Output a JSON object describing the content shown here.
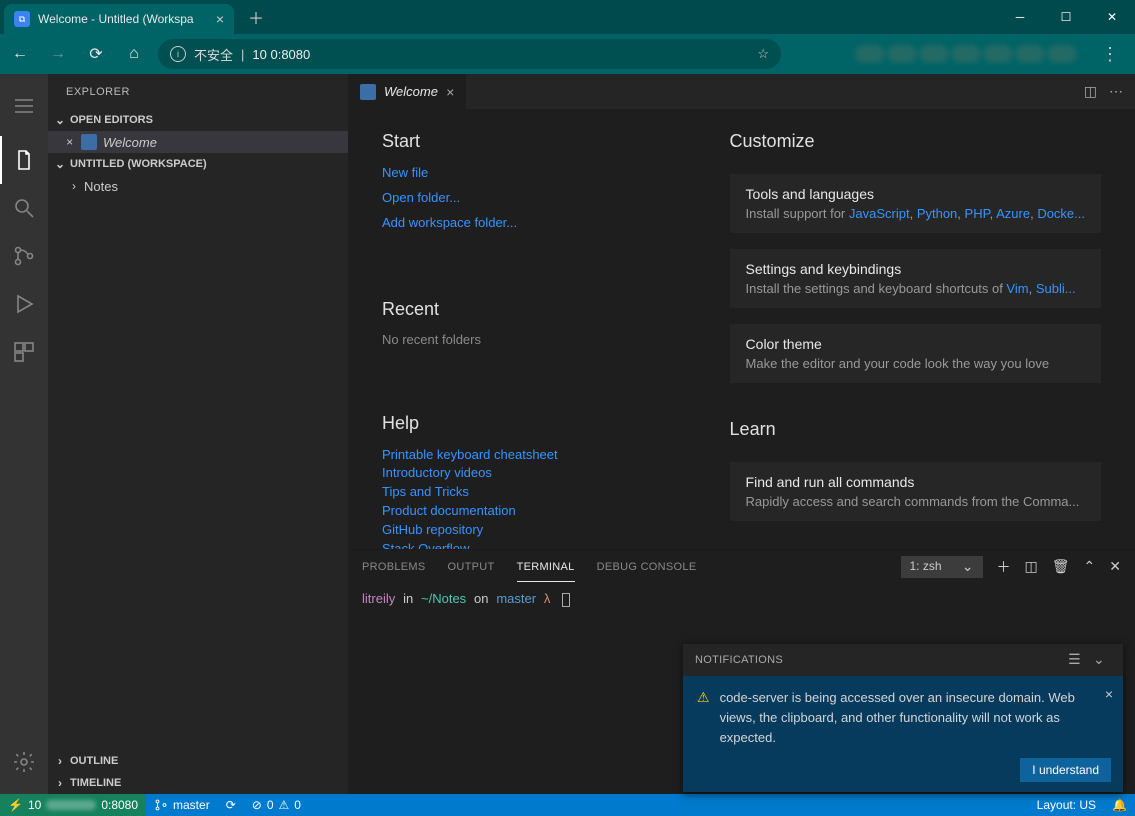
{
  "browser": {
    "tab_title": "Welcome - Untitled (Workspa",
    "insecure_label": "不安全",
    "address": "10               0:8080"
  },
  "sidebar": {
    "title": "EXPLORER",
    "open_editors": "OPEN EDITORS",
    "welcome_item": "Welcome",
    "workspace": "UNTITLED (WORKSPACE)",
    "notes": "Notes",
    "outline": "OUTLINE",
    "timeline": "TIMELINE"
  },
  "editor": {
    "tab": "Welcome"
  },
  "welcome": {
    "start": "Start",
    "new_file": "New file",
    "open_folder": "Open folder...",
    "add_workspace": "Add workspace folder...",
    "recent": "Recent",
    "no_recent": "No recent folders",
    "help": "Help",
    "help_links": [
      "Printable keyboard cheatsheet",
      "Introductory videos",
      "Tips and Tricks",
      "Product documentation",
      "GitHub repository",
      "Stack Overflow"
    ],
    "customize": "Customize",
    "card1_t": "Tools and languages",
    "card1_p_prefix": "Install support for ",
    "card1_links": [
      "JavaScript",
      "Python",
      "PHP",
      "Azure",
      "Docke..."
    ],
    "card2_t": "Settings and keybindings",
    "card2_p": "Install the settings and keyboard shortcuts of ",
    "card2_links": [
      "Vim",
      "Subli..."
    ],
    "card3_t": "Color theme",
    "card3_p": "Make the editor and your code look the way you love",
    "learn": "Learn",
    "card4_t": "Find and run all commands",
    "card4_p": "Rapidly access and search commands from the Comma..."
  },
  "panel": {
    "tabs": [
      "PROBLEMS",
      "OUTPUT",
      "TERMINAL",
      "DEBUG CONSOLE"
    ],
    "active": 2,
    "term_select": "1: zsh",
    "prompt_user": "litreily",
    "prompt_in": "in",
    "prompt_path": "~/Notes",
    "prompt_on": "on",
    "prompt_branch": "master",
    "prompt_lambda": "λ"
  },
  "notifications": {
    "title": "NOTIFICATIONS",
    "msg": "code-server is being accessed over an insecure domain. Web views, the clipboard, and other functionality will not work as expected.",
    "btn": "I understand"
  },
  "status": {
    "port": "0:8080",
    "branch": "master",
    "errors": "0",
    "warnings": "0",
    "layout": "Layout: US"
  }
}
